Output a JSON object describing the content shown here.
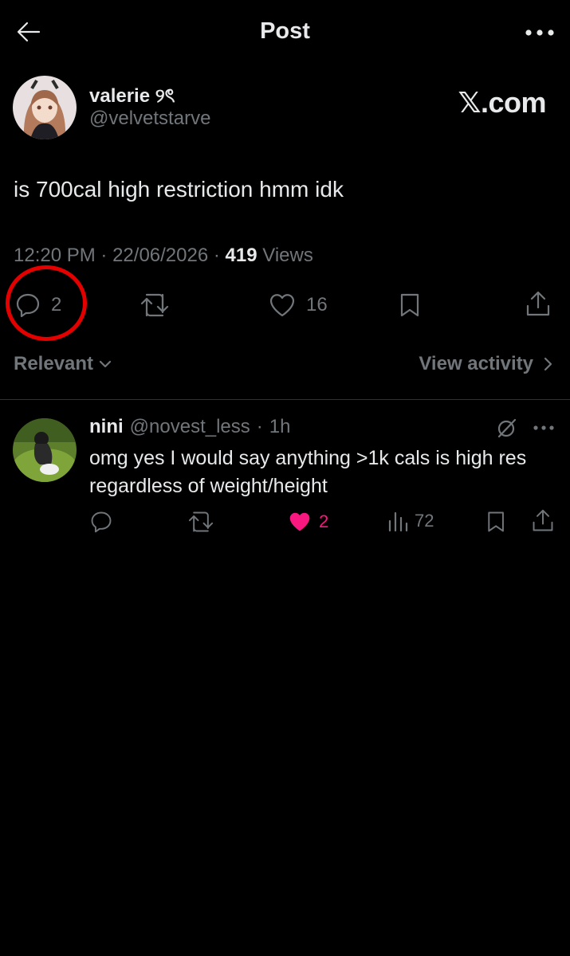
{
  "header": {
    "title": "Post"
  },
  "post": {
    "author_name": "valerie ୨ৎ",
    "author_handle": "@velvetstarve",
    "watermark": "𝕏.com",
    "text": "is 700cal high restriction hmm idk",
    "time": "12:20 PM",
    "date": "22/06/2026",
    "views_count": "419",
    "views_label": "Views",
    "sep": "·",
    "replies": "2",
    "likes": "16"
  },
  "filters": {
    "sort_label": "Relevant",
    "view_activity": "View activity"
  },
  "reply": {
    "name": "nini",
    "handle": "@novest_less",
    "sep": "·",
    "time": "1h",
    "text": "omg yes I would say anything >1k cals is high res regardless of weight/height",
    "likes": "2",
    "views": "72"
  },
  "colors": {
    "like_active": "#f91880",
    "annotation": "#e50000",
    "muted": "#71767b"
  }
}
